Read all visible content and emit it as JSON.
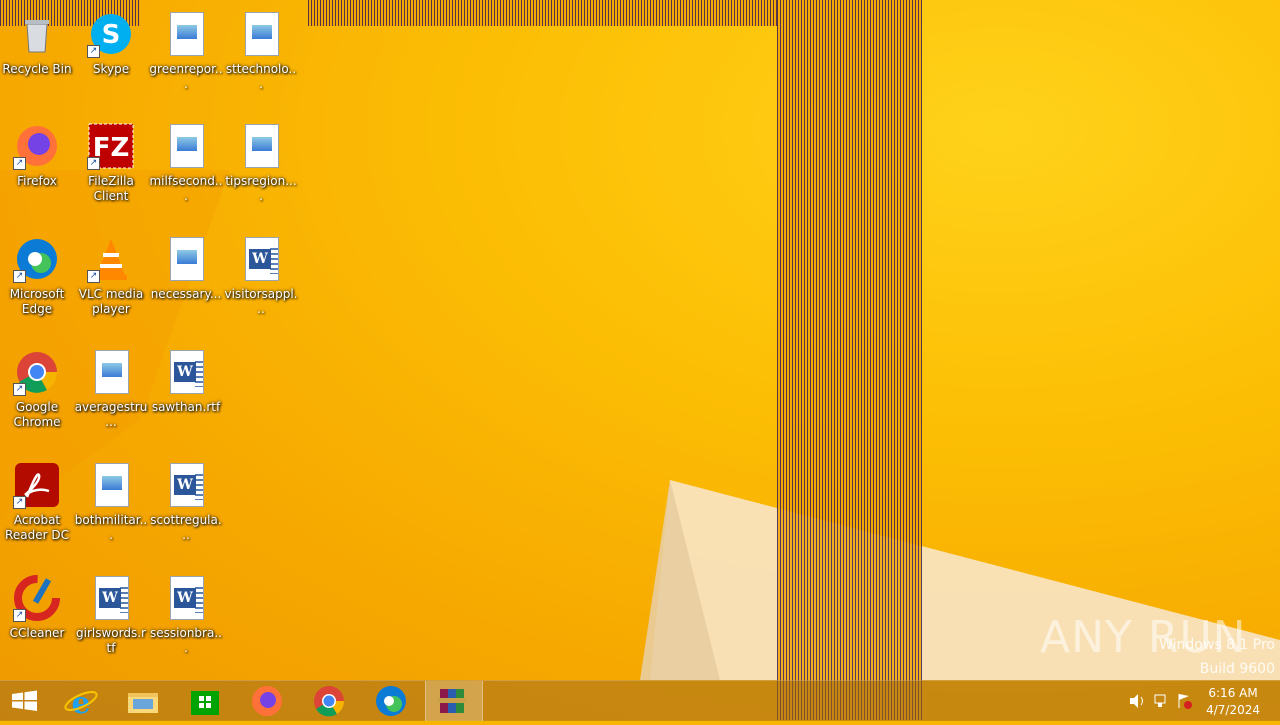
{
  "desktop": {
    "icons": [
      {
        "label": "Recycle Bin",
        "icon": "recycle-bin-icon"
      },
      {
        "label": "Skype",
        "icon": "skype-icon"
      },
      {
        "label": "greenrepor...",
        "icon": "image-file-icon"
      },
      {
        "label": "sttechnolo...",
        "icon": "image-file-icon"
      },
      {
        "label": "Firefox",
        "icon": "firefox-icon"
      },
      {
        "label": "FileZilla Client",
        "icon": "filezilla-icon"
      },
      {
        "label": "milfsecond...",
        "icon": "image-file-icon"
      },
      {
        "label": "tipsregion....",
        "icon": "image-file-icon"
      },
      {
        "label": "Microsoft Edge",
        "icon": "edge-icon"
      },
      {
        "label": "VLC media player",
        "icon": "vlc-icon"
      },
      {
        "label": "necessary...",
        "icon": "image-file-icon"
      },
      {
        "label": "visitorsappl...",
        "icon": "word-document-icon"
      },
      {
        "label": "Google Chrome",
        "icon": "chrome-icon"
      },
      {
        "label": "averagestru...",
        "icon": "image-file-icon"
      },
      {
        "label": "sawthan.rtf",
        "icon": "word-document-icon"
      },
      {
        "label": "Acrobat Reader DC",
        "icon": "acrobat-icon"
      },
      {
        "label": "bothmilitar...",
        "icon": "image-file-icon"
      },
      {
        "label": "scottregula...",
        "icon": "word-document-icon"
      },
      {
        "label": "CCleaner",
        "icon": "ccleaner-icon"
      },
      {
        "label": "girlswords.rtf",
        "icon": "word-document-icon"
      },
      {
        "label": "sessionbra...",
        "icon": "word-document-icon"
      }
    ]
  },
  "taskbar": {
    "buttons": [
      {
        "name": "start-button",
        "icon": "windows-logo-icon"
      },
      {
        "name": "internet-explorer",
        "icon": "internet-explorer-icon"
      },
      {
        "name": "file-explorer",
        "icon": "folder-icon"
      },
      {
        "name": "store",
        "icon": "store-icon"
      },
      {
        "name": "firefox",
        "icon": "firefox-icon"
      },
      {
        "name": "chrome",
        "icon": "chrome-icon"
      },
      {
        "name": "edge",
        "icon": "edge-icon"
      },
      {
        "name": "winrar",
        "icon": "winrar-icon",
        "active": true
      }
    ],
    "tray": {
      "icons": [
        "speaker-icon",
        "network-icon",
        "action-center-icon"
      ]
    },
    "clock": {
      "time": "6:16 AM",
      "date": "4/7/2024"
    }
  },
  "watermark": {
    "edition": "Windows 8.1 Pro",
    "build": "Build 9600",
    "brand": "ANY RUN"
  },
  "colors": {
    "wallpaper": "#f7b500",
    "stripe": "#3a1a55",
    "word_blue": "#2b579a"
  }
}
